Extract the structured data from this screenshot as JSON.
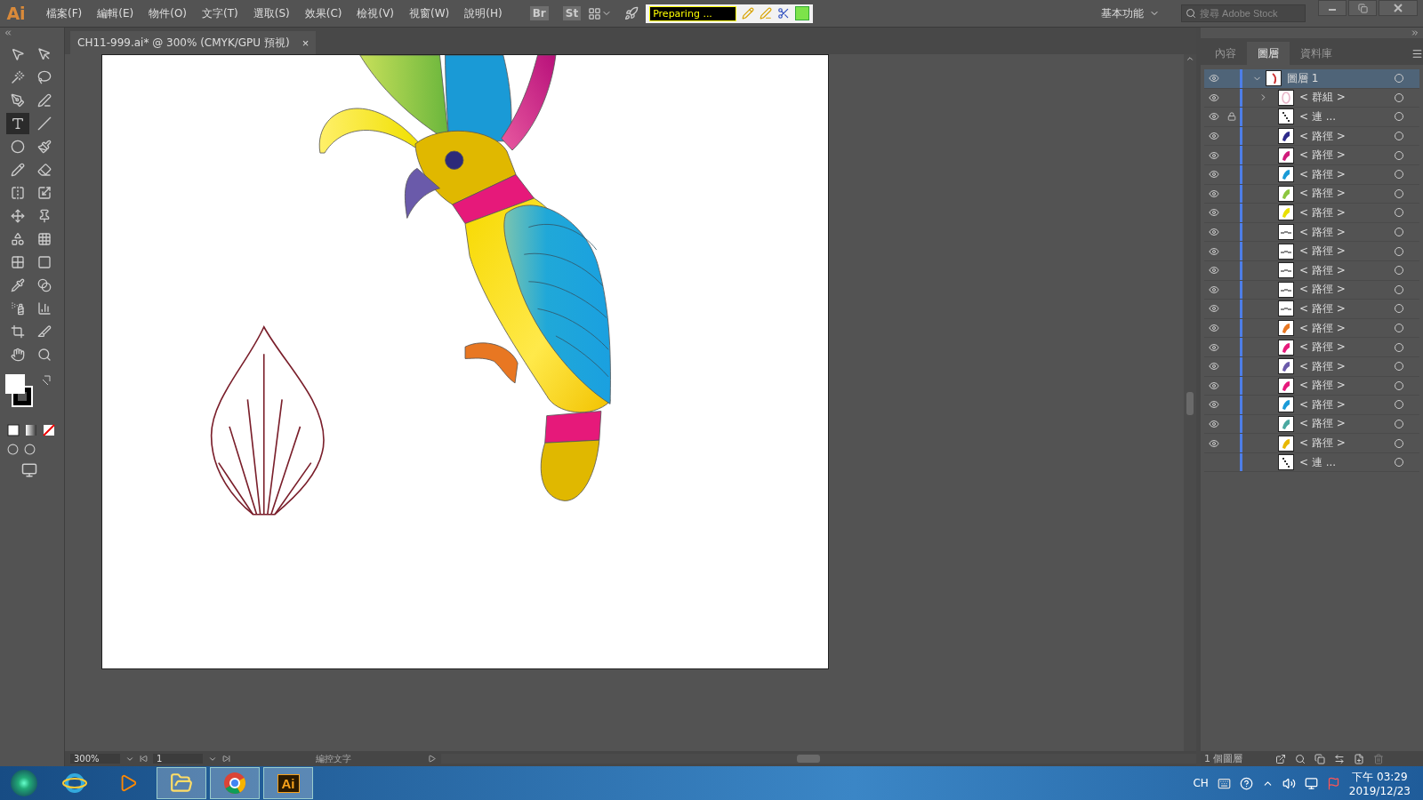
{
  "app": {
    "logo": "Ai"
  },
  "menu": [
    "檔案(F)",
    "編輯(E)",
    "物件(O)",
    "文字(T)",
    "選取(S)",
    "效果(C)",
    "檢視(V)",
    "視窗(W)",
    "說明(H)"
  ],
  "toolbar": {
    "bridge": "Br",
    "stock": "St",
    "status": "Preparing ...",
    "workspace": "基本功能",
    "search_placeholder": "搜尋 Adobe Stock"
  },
  "document_tab": {
    "title": "CH11-999.ai* @ 300% (CMYK/GPU 預視)",
    "close": "×",
    "selected": true
  },
  "tools": [
    {
      "kind": "select",
      "selected": false
    },
    {
      "kind": "direct",
      "selected": false
    },
    {
      "kind": "wand",
      "selected": false
    },
    {
      "kind": "lasso",
      "selected": false
    },
    {
      "kind": "pen",
      "selected": false
    },
    {
      "kind": "curvature",
      "selected": false
    },
    {
      "kind": "type",
      "selected": true
    },
    {
      "kind": "line",
      "selected": false
    },
    {
      "kind": "ellipse",
      "selected": false
    },
    {
      "kind": "brush",
      "selected": false
    },
    {
      "kind": "shaper",
      "selected": false
    },
    {
      "kind": "eraser",
      "selected": false
    },
    {
      "kind": "reflect",
      "selected": false
    },
    {
      "kind": "scale",
      "selected": false
    },
    {
      "kind": "warp",
      "selected": false
    },
    {
      "kind": "pin",
      "selected": false
    },
    {
      "kind": "shapebuilder",
      "selected": false
    },
    {
      "kind": "perspective",
      "selected": false
    },
    {
      "kind": "mesh",
      "selected": false
    },
    {
      "kind": "gradient",
      "selected": false
    },
    {
      "kind": "eyedropper",
      "selected": false
    },
    {
      "kind": "blend",
      "selected": false
    },
    {
      "kind": "symbol",
      "selected": false
    },
    {
      "kind": "graph",
      "selected": false
    },
    {
      "kind": "artboard",
      "selected": false
    },
    {
      "kind": "slice",
      "selected": false
    },
    {
      "kind": "hand",
      "selected": false
    },
    {
      "kind": "zoom",
      "selected": false
    }
  ],
  "panel": {
    "tabs": [
      {
        "label": "內容",
        "selected": false
      },
      {
        "label": "圖層",
        "selected": true
      },
      {
        "label": "資料庫",
        "selected": false
      }
    ],
    "layer": {
      "name": "圖層 1",
      "visible": true,
      "selected": true,
      "expanded": true,
      "children": [
        {
          "kind": "group",
          "name": "< 群組 >",
          "visible": true,
          "locked": false,
          "expanded": false,
          "color": "#e8b4c8"
        },
        {
          "kind": "compound",
          "name": "< 連 ...",
          "visible": true,
          "locked": true,
          "color": "#333333"
        },
        {
          "kind": "path",
          "name": "< 路徑 >",
          "visible": true,
          "locked": false,
          "color": "#2d2a8a"
        },
        {
          "kind": "path",
          "name": "< 路徑 >",
          "visible": true,
          "locked": false,
          "color": "#d01a7a"
        },
        {
          "kind": "path",
          "name": "< 路徑 >",
          "visible": true,
          "locked": false,
          "color": "#1a9ad6"
        },
        {
          "kind": "path",
          "name": "< 路徑 >",
          "visible": true,
          "locked": false,
          "color": "#8cc63f"
        },
        {
          "kind": "path",
          "name": "< 路徑 >",
          "visible": true,
          "locked": false,
          "color": "#e8e000"
        },
        {
          "kind": "stroke",
          "name": "< 路徑 >",
          "visible": true,
          "locked": false,
          "color": "#888888"
        },
        {
          "kind": "stroke",
          "name": "< 路徑 >",
          "visible": true,
          "locked": false,
          "color": "#888888"
        },
        {
          "kind": "stroke",
          "name": "< 路徑 >",
          "visible": true,
          "locked": false,
          "color": "#888888"
        },
        {
          "kind": "stroke",
          "name": "< 路徑 >",
          "visible": true,
          "locked": false,
          "color": "#888888"
        },
        {
          "kind": "stroke",
          "name": "< 路徑 >",
          "visible": true,
          "locked": false,
          "color": "#888888"
        },
        {
          "kind": "path",
          "name": "< 路徑 >",
          "visible": true,
          "locked": false,
          "color": "#e87722"
        },
        {
          "kind": "path",
          "name": "< 路徑 >",
          "visible": true,
          "locked": false,
          "color": "#e6197a"
        },
        {
          "kind": "path",
          "name": "< 路徑 >",
          "visible": true,
          "locked": false,
          "color": "#6a5aaa"
        },
        {
          "kind": "path",
          "name": "< 路徑 >",
          "visible": true,
          "locked": false,
          "color": "#e6197b"
        },
        {
          "kind": "path",
          "name": "< 路徑 >",
          "visible": true,
          "locked": false,
          "color": "#1a9ad7"
        },
        {
          "kind": "path",
          "name": "< 路徑 >",
          "visible": true,
          "locked": false,
          "color": "#4aa8a0"
        },
        {
          "kind": "path",
          "name": "< 路徑 >",
          "visible": true,
          "locked": false,
          "color": "#e8b800"
        },
        {
          "kind": "compound",
          "name": "< 連 ...",
          "visible": false,
          "locked": false,
          "color": "#333333"
        }
      ]
    },
    "footer": "1 個圖層"
  },
  "status_bar": {
    "zoom": "300%",
    "artboard": "1",
    "status": "編控文字"
  },
  "taskbar": {
    "ai_label": "Ai",
    "language": "CH",
    "time": "下午 03:29",
    "date": "2019/12/23"
  }
}
